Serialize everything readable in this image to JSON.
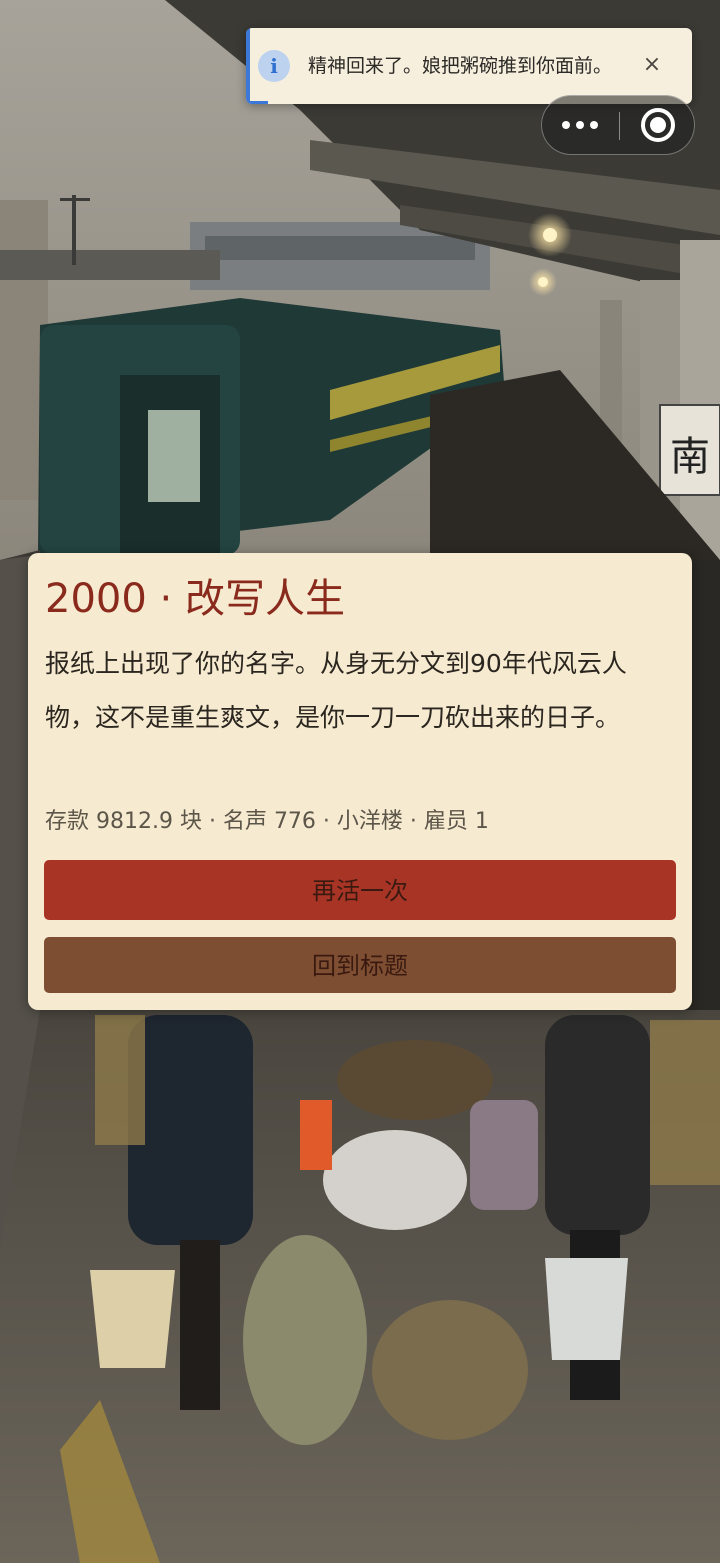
{
  "toast": {
    "icon": "info-icon",
    "info_glyph": "i",
    "message": "精神回来了。娘把粥碗推到你面前。",
    "close_glyph": "×",
    "progress": 0.04
  },
  "capsule": {
    "more_icon": "more-dots-icon",
    "close_icon": "target-close-icon"
  },
  "scene": {
    "station_sign": "南"
  },
  "ending": {
    "title": "2000 · 改写人生",
    "body": "报纸上出现了你的名字。从身无分文到90年代风云人物，这不是重生爽文，是你一刀一刀砍出来的日子。",
    "stats": "存款 9812.9 块 · 名声 776 · 小洋楼 · 雇员 1",
    "retry_label": "再活一次",
    "title_label": "回到标题"
  },
  "colors": {
    "card_bg": "#f6ead0",
    "title_red": "#8a2a1c",
    "retry_button": "#a83426",
    "title_button": "#7e4e32",
    "toast_accent": "#3b78d8"
  }
}
